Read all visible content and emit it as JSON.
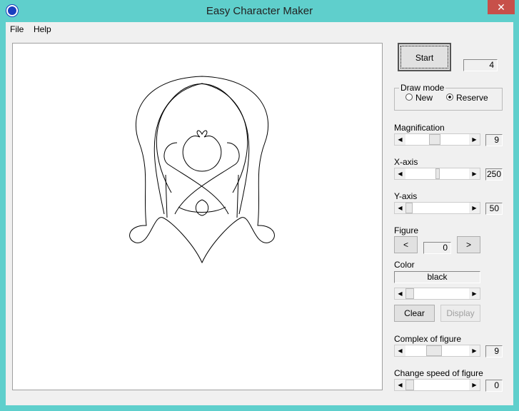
{
  "window": {
    "title": "Easy Character Maker",
    "close": "✕"
  },
  "menu": [
    "File",
    "Help"
  ],
  "start": {
    "label": "Start",
    "count": "4"
  },
  "draw_mode": {
    "label": "Draw mode",
    "options": [
      "New",
      "Reserve"
    ],
    "selected": "Reserve"
  },
  "magnification": {
    "label": "Magnification",
    "value": "9",
    "position": 0.4
  },
  "x_axis": {
    "label": "X-axis",
    "value": "250",
    "position": 0.5
  },
  "y_axis": {
    "label": "Y-axis",
    "value": "50",
    "position": 0.05
  },
  "figure": {
    "label": "Figure",
    "prev": "<",
    "next": ">",
    "value": "0"
  },
  "color": {
    "label": "Color",
    "value": "black",
    "position": 0.05
  },
  "buttons": {
    "clear": "Clear",
    "display": "Display"
  },
  "complex": {
    "label": "Complex of figure",
    "value": "9",
    "position": 0.4
  },
  "speed": {
    "label": "Change speed of figure",
    "value": "0",
    "position": 0.05
  }
}
